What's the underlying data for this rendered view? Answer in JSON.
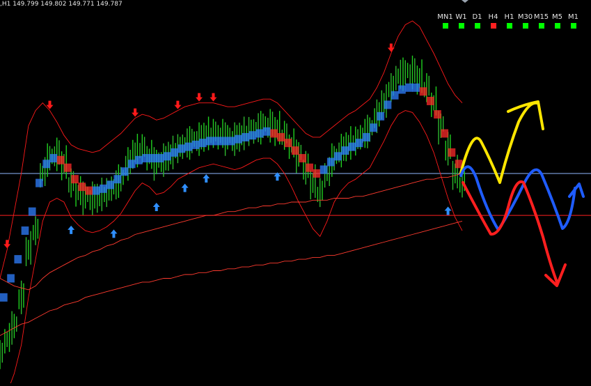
{
  "ohlc_text": ",H1  149.799 149.802 149.771 149.787",
  "timeframes": [
    {
      "label": "MN1",
      "status_color": "#00ff00"
    },
    {
      "label": "W1",
      "status_color": "#00ff00"
    },
    {
      "label": "D1",
      "status_color": "#00ff00"
    },
    {
      "label": "H4",
      "status_color": "#ff2020"
    },
    {
      "label": "H1",
      "status_color": "#00ff00"
    },
    {
      "label": "M30",
      "status_color": "#00ff00"
    },
    {
      "label": "M15",
      "status_color": "#00ff00"
    },
    {
      "label": "M5",
      "status_color": "#00ff00"
    },
    {
      "label": "M1",
      "status_color": "#00ff00"
    }
  ],
  "chart_data": {
    "type": "line",
    "x": [
      1,
      2,
      3,
      4,
      5,
      6,
      7,
      8,
      9,
      10,
      11,
      12,
      13,
      14,
      15,
      16,
      17,
      18,
      19,
      20,
      21,
      22,
      23,
      24,
      25,
      26,
      27,
      28,
      29,
      30,
      31,
      32,
      33,
      34,
      35,
      36,
      37,
      38,
      39,
      40,
      41,
      42,
      43,
      44,
      45,
      46,
      47,
      48,
      49,
      50,
      51,
      52,
      53,
      54,
      55,
      56,
      57,
      58,
      59,
      60,
      61,
      62,
      63,
      64,
      65,
      66
    ],
    "series": [
      {
        "values": [
          149.3,
          149.38,
          149.45,
          149.6,
          149.85,
          149.95,
          150.25,
          150.33,
          150.35,
          150.3,
          150.2,
          150.15,
          150.13,
          150.12,
          150.13,
          150.15,
          150.18,
          150.22,
          150.3,
          150.36,
          150.38,
          150.34,
          150.31,
          150.32,
          150.35,
          150.38,
          150.4,
          150.42,
          150.43,
          150.45,
          150.46,
          150.45,
          150.44,
          150.43,
          150.45,
          150.47,
          150.48,
          150.5,
          150.5,
          150.48,
          150.45,
          150.4,
          150.35,
          150.28,
          150.2,
          150.15,
          150.25,
          150.33,
          150.37,
          150.4,
          150.42,
          150.45,
          150.48,
          150.55,
          150.62,
          150.7,
          150.76,
          150.78,
          150.78,
          150.75,
          150.7,
          150.62,
          150.5,
          150.38,
          150.25,
          150.2
        ]
      },
      {
        "values": [
          149.5,
          149.6,
          149.7,
          149.8,
          149.95,
          150.05,
          150.2,
          150.3,
          150.33,
          150.32,
          150.28,
          150.22,
          150.18,
          150.16,
          150.16,
          150.17,
          150.19,
          150.22,
          150.26,
          150.3,
          150.32,
          150.33,
          150.33,
          150.33,
          150.34,
          150.36,
          150.38,
          150.39,
          150.4,
          150.41,
          150.42,
          150.42,
          150.42,
          150.42,
          150.43,
          150.44,
          150.45,
          150.46,
          150.47,
          150.46,
          150.44,
          150.41,
          150.37,
          150.33,
          150.28,
          150.25,
          150.27,
          150.31,
          150.34,
          150.37,
          150.39,
          150.41,
          150.44,
          150.49,
          150.55,
          150.61,
          150.66,
          150.69,
          150.7,
          150.7,
          150.68,
          150.63,
          150.56,
          150.46,
          150.36,
          150.3
        ]
      },
      {
        "values": [
          149.7,
          149.68,
          149.66,
          149.65,
          149.64,
          149.66,
          149.7,
          149.73,
          149.75,
          149.77,
          149.79,
          149.81,
          149.82,
          149.84,
          149.85,
          149.87,
          149.88,
          149.9,
          149.91,
          149.93,
          149.94,
          149.95,
          149.96,
          149.97,
          149.98,
          149.99,
          150.0,
          150.01,
          150.02,
          150.03,
          150.03,
          150.04,
          150.05,
          150.05,
          150.06,
          150.07,
          150.07,
          150.08,
          150.08,
          150.09,
          150.09,
          150.1,
          150.1,
          150.1,
          150.11,
          150.11,
          150.11,
          150.12,
          150.12,
          150.12,
          150.13,
          150.13,
          150.14,
          150.15,
          150.16,
          150.17,
          150.18,
          150.19,
          150.2,
          150.21,
          150.22,
          150.22,
          150.23,
          150.23,
          150.24,
          150.25
        ]
      },
      {
        "values": [
          149.4,
          149.42,
          149.44,
          149.46,
          149.47,
          149.49,
          149.51,
          149.53,
          149.54,
          149.56,
          149.57,
          149.58,
          149.6,
          149.61,
          149.62,
          149.63,
          149.64,
          149.65,
          149.66,
          149.67,
          149.68,
          149.68,
          149.69,
          149.7,
          149.7,
          149.71,
          149.72,
          149.72,
          149.73,
          149.73,
          149.74,
          149.74,
          149.75,
          149.75,
          149.76,
          149.76,
          149.77,
          149.77,
          149.78,
          149.78,
          149.79,
          149.79,
          149.8,
          149.8,
          149.81,
          149.81,
          149.82,
          149.82,
          149.83,
          149.84,
          149.85,
          149.86,
          149.87,
          149.88,
          149.89,
          149.9,
          149.91,
          149.92,
          149.93,
          149.94,
          149.95,
          149.96,
          149.97,
          149.98,
          149.99,
          150.0
        ]
      }
    ],
    "upper_envelope": [
      149.7,
      149.85,
      150.05,
      150.25,
      150.5,
      150.58,
      150.62,
      150.58,
      150.52,
      150.45,
      150.4,
      150.38,
      150.37,
      150.36,
      150.37,
      150.4,
      150.43,
      150.46,
      150.5,
      150.54,
      150.56,
      150.55,
      150.53,
      150.54,
      150.56,
      150.58,
      150.6,
      150.61,
      150.62,
      150.62,
      150.62,
      150.61,
      150.6,
      150.6,
      150.61,
      150.62,
      150.63,
      150.64,
      150.64,
      150.62,
      150.58,
      150.54,
      150.5,
      150.46,
      150.44,
      150.44,
      150.47,
      150.5,
      150.53,
      150.56,
      150.58,
      150.61,
      150.64,
      150.7,
      150.78,
      150.88,
      150.97,
      151.03,
      151.05,
      151.02,
      150.95,
      150.88,
      150.8,
      150.72,
      150.66,
      150.62
    ],
    "lower_envelope": [
      149.05,
      149.1,
      149.2,
      149.35,
      149.6,
      149.8,
      150.0,
      150.1,
      150.12,
      150.1,
      150.02,
      149.98,
      149.95,
      149.94,
      149.95,
      149.97,
      150.0,
      150.04,
      150.1,
      150.16,
      150.2,
      150.18,
      150.14,
      150.15,
      150.18,
      150.22,
      150.24,
      150.26,
      150.28,
      150.29,
      150.3,
      150.29,
      150.28,
      150.27,
      150.28,
      150.3,
      150.32,
      150.33,
      150.33,
      150.3,
      150.25,
      150.18,
      150.1,
      150.03,
      149.96,
      149.92,
      150.0,
      150.1,
      150.16,
      150.2,
      150.22,
      150.25,
      150.28,
      150.35,
      150.42,
      150.5,
      150.56,
      150.58,
      150.57,
      150.52,
      150.45,
      150.36,
      150.24,
      150.12,
      150.02,
      149.95
    ],
    "horizontal_lines": [
      {
        "y": 150.25,
        "color": "#8fb8ff"
      },
      {
        "y": 150.03,
        "color": "#ff2020"
      }
    ],
    "buy_arrows_x": [
      11,
      17,
      23,
      27,
      30,
      40,
      64
    ],
    "sell_arrows_x": [
      2,
      8,
      20,
      26,
      29,
      31,
      56
    ],
    "ylim": [
      149.15,
      151.05
    ],
    "xlim": [
      1,
      66
    ],
    "grid": false,
    "legend": "none",
    "colors": {
      "background": "#000000",
      "bull": "#1fd11f",
      "bear": "#2fb82f",
      "blue_band": "#2f7fff",
      "red_band": "#ff2a2a",
      "envelope": "#ff1a1a",
      "ma": "#ff3b2f",
      "buy_arrow": "#2f8fff",
      "sell_arrow": "#ff1a1a",
      "annotation_yellow": "#ffe600",
      "annotation_blue": "#1f5cff",
      "annotation_red": "#ff1f1f"
    }
  }
}
